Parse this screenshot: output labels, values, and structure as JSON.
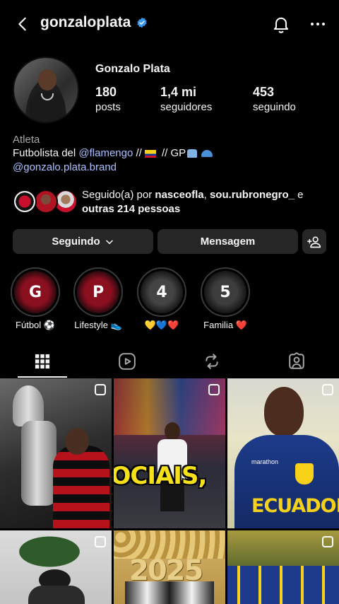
{
  "header": {
    "username": "gonzaloplata",
    "verified": true,
    "icons": [
      "back-arrow-icon",
      "verified-badge-icon",
      "bell-icon",
      "more-icon"
    ]
  },
  "profile": {
    "display_name": "Gonzalo Plata",
    "stats": [
      {
        "value": "180",
        "label": "posts"
      },
      {
        "value": "1,4 mi",
        "label": "seguidores"
      },
      {
        "value": "453",
        "label": "seguindo"
      }
    ],
    "category": "Atleta",
    "bio": {
      "prefix": "Futbolista del ",
      "mention": "@flamengo",
      "middle": " //",
      "suffix": "  // GP",
      "link": "@gonzalo.plata.brand"
    }
  },
  "followed_by": {
    "prefix": "Seguido(a) por ",
    "user1": "nasceofla",
    "sep": ", ",
    "user2": "sou.rubronegro_",
    "conj": " e",
    "others": "outras 214 pessoas"
  },
  "actions": {
    "following_label": "Seguindo",
    "message_label": "Mensagem"
  },
  "highlights": [
    {
      "letter": "G",
      "label": "Fútbol ⚽"
    },
    {
      "letter": "P",
      "label": "Lifestyle 👟"
    },
    {
      "letter": "4",
      "label": "💛💙❤️"
    },
    {
      "letter": "5",
      "label": "Familia ❤️"
    }
  ],
  "tabs": [
    "grid-icon",
    "reels-icon",
    "reposts-icon",
    "tagged-icon"
  ],
  "posts": {
    "caption_text": "SOCIAIS,",
    "jersey_text": "ECUADOR",
    "jersey_brand": "marathon",
    "year_text": "2025"
  },
  "colors": {
    "background": "#000000",
    "button": "#262626",
    "link": "#a8c0ff",
    "verified": "#3897f0",
    "flamengo_red": "#c8102e"
  }
}
